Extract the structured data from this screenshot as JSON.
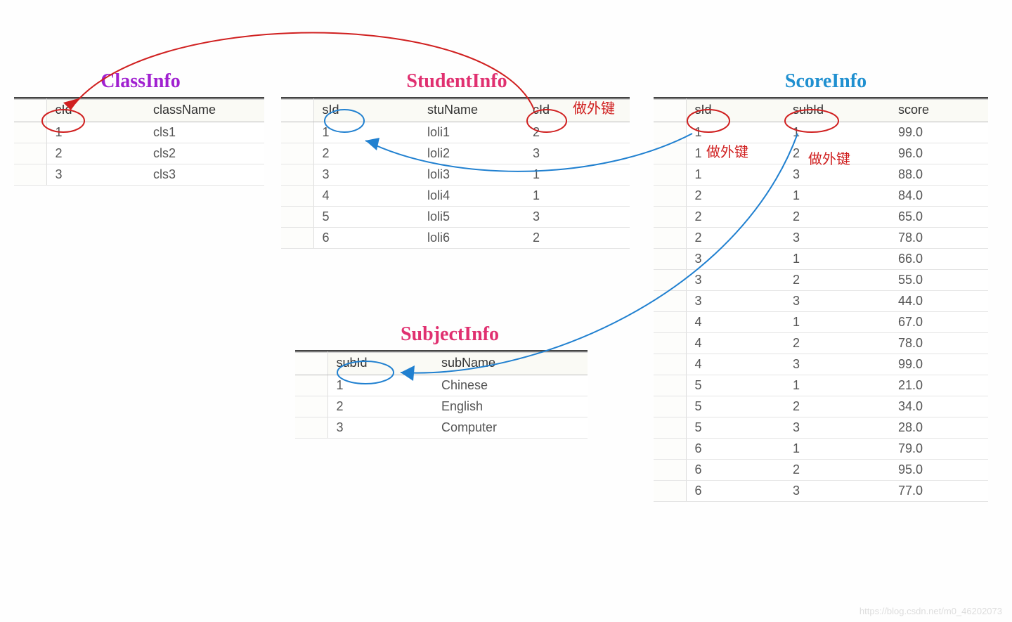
{
  "class_info": {
    "title": "ClassInfo",
    "headers": [
      "cId",
      "className"
    ],
    "rows": [
      [
        "1",
        "cls1"
      ],
      [
        "2",
        "cls2"
      ],
      [
        "3",
        "cls3"
      ]
    ]
  },
  "student_info": {
    "title": "StudentInfo",
    "headers": [
      "sId",
      "stuName",
      "cId"
    ],
    "rows": [
      [
        "1",
        "loli1",
        "2"
      ],
      [
        "2",
        "loli2",
        "3"
      ],
      [
        "3",
        "loli3",
        "1"
      ],
      [
        "4",
        "loli4",
        "1"
      ],
      [
        "5",
        "loli5",
        "3"
      ],
      [
        "6",
        "loli6",
        "2"
      ]
    ]
  },
  "subject_info": {
    "title": "SubjectInfo",
    "headers": [
      "subId",
      "subName"
    ],
    "rows": [
      [
        "1",
        "Chinese"
      ],
      [
        "2",
        "English"
      ],
      [
        "3",
        "Computer"
      ]
    ]
  },
  "score_info": {
    "title": "ScoreInfo",
    "headers": [
      "sId",
      "subId",
      "score"
    ],
    "rows": [
      [
        "1",
        "1",
        "99.0"
      ],
      [
        "1",
        "2",
        "96.0"
      ],
      [
        "1",
        "3",
        "88.0"
      ],
      [
        "2",
        "1",
        "84.0"
      ],
      [
        "2",
        "2",
        "65.0"
      ],
      [
        "2",
        "3",
        "78.0"
      ],
      [
        "3",
        "1",
        "66.0"
      ],
      [
        "3",
        "2",
        "55.0"
      ],
      [
        "3",
        "3",
        "44.0"
      ],
      [
        "4",
        "1",
        "67.0"
      ],
      [
        "4",
        "2",
        "78.0"
      ],
      [
        "4",
        "3",
        "99.0"
      ],
      [
        "5",
        "1",
        "21.0"
      ],
      [
        "5",
        "2",
        "34.0"
      ],
      [
        "5",
        "3",
        "28.0"
      ],
      [
        "6",
        "1",
        "79.0"
      ],
      [
        "6",
        "2",
        "95.0"
      ],
      [
        "6",
        "3",
        "77.0"
      ]
    ]
  },
  "annotations": {
    "fk1": "做外键",
    "fk2": "做外键",
    "fk3": "做外键"
  },
  "watermark": "https://blog.csdn.net/m0_46202073"
}
